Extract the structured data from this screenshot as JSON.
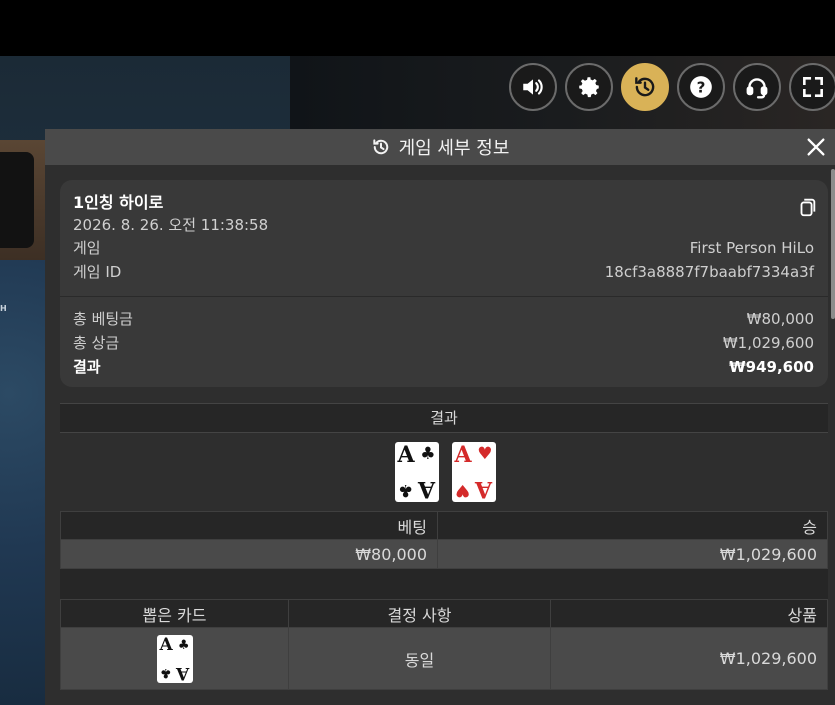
{
  "controls": {
    "sound_icon": "speaker-icon",
    "settings_icon": "gear-icon",
    "history_icon": "history-icon",
    "help_icon": "help-icon",
    "support_icon": "headset-icon",
    "fullscreen_icon": "fullscreen-icon",
    "accent": "#d9b257"
  },
  "background": {
    "felt_text": "H"
  },
  "panel": {
    "title": "게임 세부 정보",
    "header_icon": "history-icon",
    "close_icon": "close-icon"
  },
  "summary": {
    "game_title": "1인칭 하이로",
    "datetime": "2026. 8. 26. 오전 11:38:58",
    "game_label": "게임",
    "game_value": "First Person HiLo",
    "game_id_label": "게임 ID",
    "game_id_value": "18cf3a8887f7baabf7334a3f",
    "total_bet_label": "총 베팅금",
    "total_bet_value": "₩80,000",
    "total_win_label": "총 상금",
    "total_win_value": "₩1,029,600",
    "result_label": "결과",
    "result_value": "₩949,600"
  },
  "result_section": {
    "title": "결과",
    "cards": [
      {
        "rank": "A",
        "suit": "♣",
        "color": "black"
      },
      {
        "rank": "A",
        "suit": "♥",
        "color": "red"
      }
    ]
  },
  "bet_table": {
    "headers": [
      "베팅",
      "승"
    ],
    "rows": [
      [
        "₩80,000",
        "₩1,029,600"
      ]
    ]
  },
  "draw_table": {
    "headers": [
      "뽑은 카드",
      "결정 사항",
      "상품"
    ],
    "rows": [
      {
        "card": {
          "rank": "A",
          "suit": "♣",
          "color": "black"
        },
        "decision": "동일",
        "prize": "₩1,029,600"
      }
    ]
  }
}
